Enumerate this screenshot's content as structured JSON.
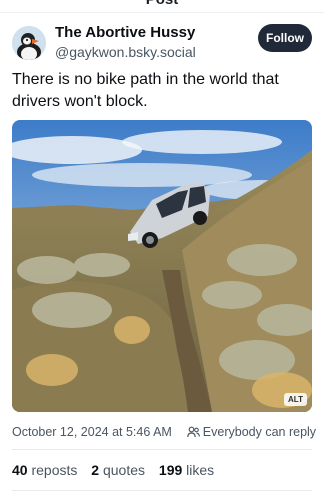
{
  "header": {
    "title": "Post"
  },
  "author": {
    "display_name": "The Abortive Hussy",
    "handle": "@gaykwon.bsky.social",
    "follow_label": "Follow",
    "avatar_icon": "puffin-avatar"
  },
  "post": {
    "text": "There is no bike path in the world that drivers won't block.",
    "image_alt_badge": "ALT",
    "timestamp": "October 12, 2024 at 5:46 AM",
    "reply_setting": "Everybody can reply",
    "reply_icon": "people-icon"
  },
  "stats": {
    "reposts_count": "40",
    "reposts_label": "reposts",
    "quotes_count": "2",
    "quotes_label": "quotes",
    "likes_count": "199",
    "likes_label": "likes"
  },
  "colors": {
    "follow_button": "#1f2937",
    "secondary_text": "#4a5563",
    "primary_text": "#0b0f14"
  }
}
